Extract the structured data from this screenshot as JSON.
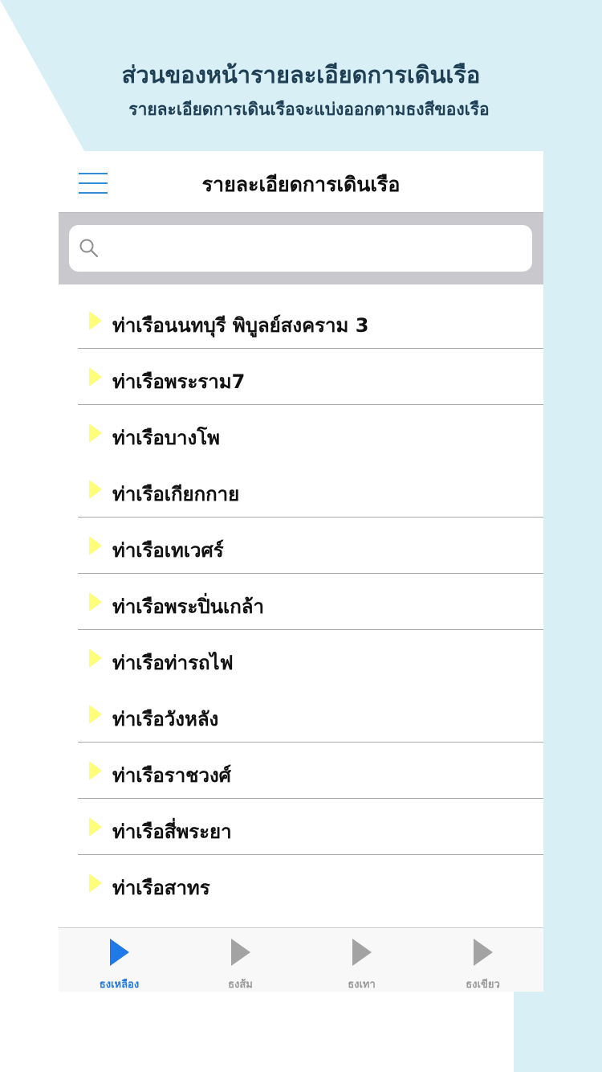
{
  "promo": {
    "title": "ส่วนของหน้ารายละเอียดการเดินเรือ",
    "subtitle": "รายละเอียดการเดินเรือจะแบ่งออกตามธงสีของเรือ"
  },
  "colors": {
    "background_accent": "#d9eff6",
    "active_tab": "#1f7ae8",
    "inactive_tab": "#9a9a9a",
    "flag_yellow": "#fefe7a",
    "menu_icon": "#2f8fd8",
    "search_bar_bg": "#c8c8cd"
  },
  "navbar": {
    "title": "รายละเอียดการเดินเรือ",
    "menu_icon": "hamburger-menu-icon"
  },
  "search": {
    "placeholder": "",
    "value": "",
    "icon": "search-icon"
  },
  "piers": [
    {
      "label": "ท่าเรือนนทบุรี พิบูลย์สงคราม 3",
      "separator": true
    },
    {
      "label": "ท่าเรือพระราม7",
      "separator": true
    },
    {
      "label": "ท่าเรือบางโพ",
      "separator": false
    },
    {
      "label": "ท่าเรือเกียกกาย",
      "separator": true
    },
    {
      "label": "ท่าเรือเทเวศร์",
      "separator": true
    },
    {
      "label": "ท่าเรือพระปิ่นเกล้า",
      "separator": true
    },
    {
      "label": "ท่าเรือท่ารถไฟ",
      "separator": false
    },
    {
      "label": "ท่าเรือวังหลัง",
      "separator": true
    },
    {
      "label": "ท่าเรือราชวงศ์",
      "separator": true
    },
    {
      "label": "ท่าเรือสี่พระยา",
      "separator": true
    },
    {
      "label": "ท่าเรือสาทร",
      "separator": false
    }
  ],
  "tabs": [
    {
      "label": "ธงเหลือง",
      "icon": "play-triangle-icon",
      "active": true
    },
    {
      "label": "ธงส้ม",
      "icon": "play-triangle-icon",
      "active": false
    },
    {
      "label": "ธงเทา",
      "icon": "play-triangle-icon",
      "active": false
    },
    {
      "label": "ธงเขียว",
      "icon": "play-triangle-icon",
      "active": false
    }
  ]
}
